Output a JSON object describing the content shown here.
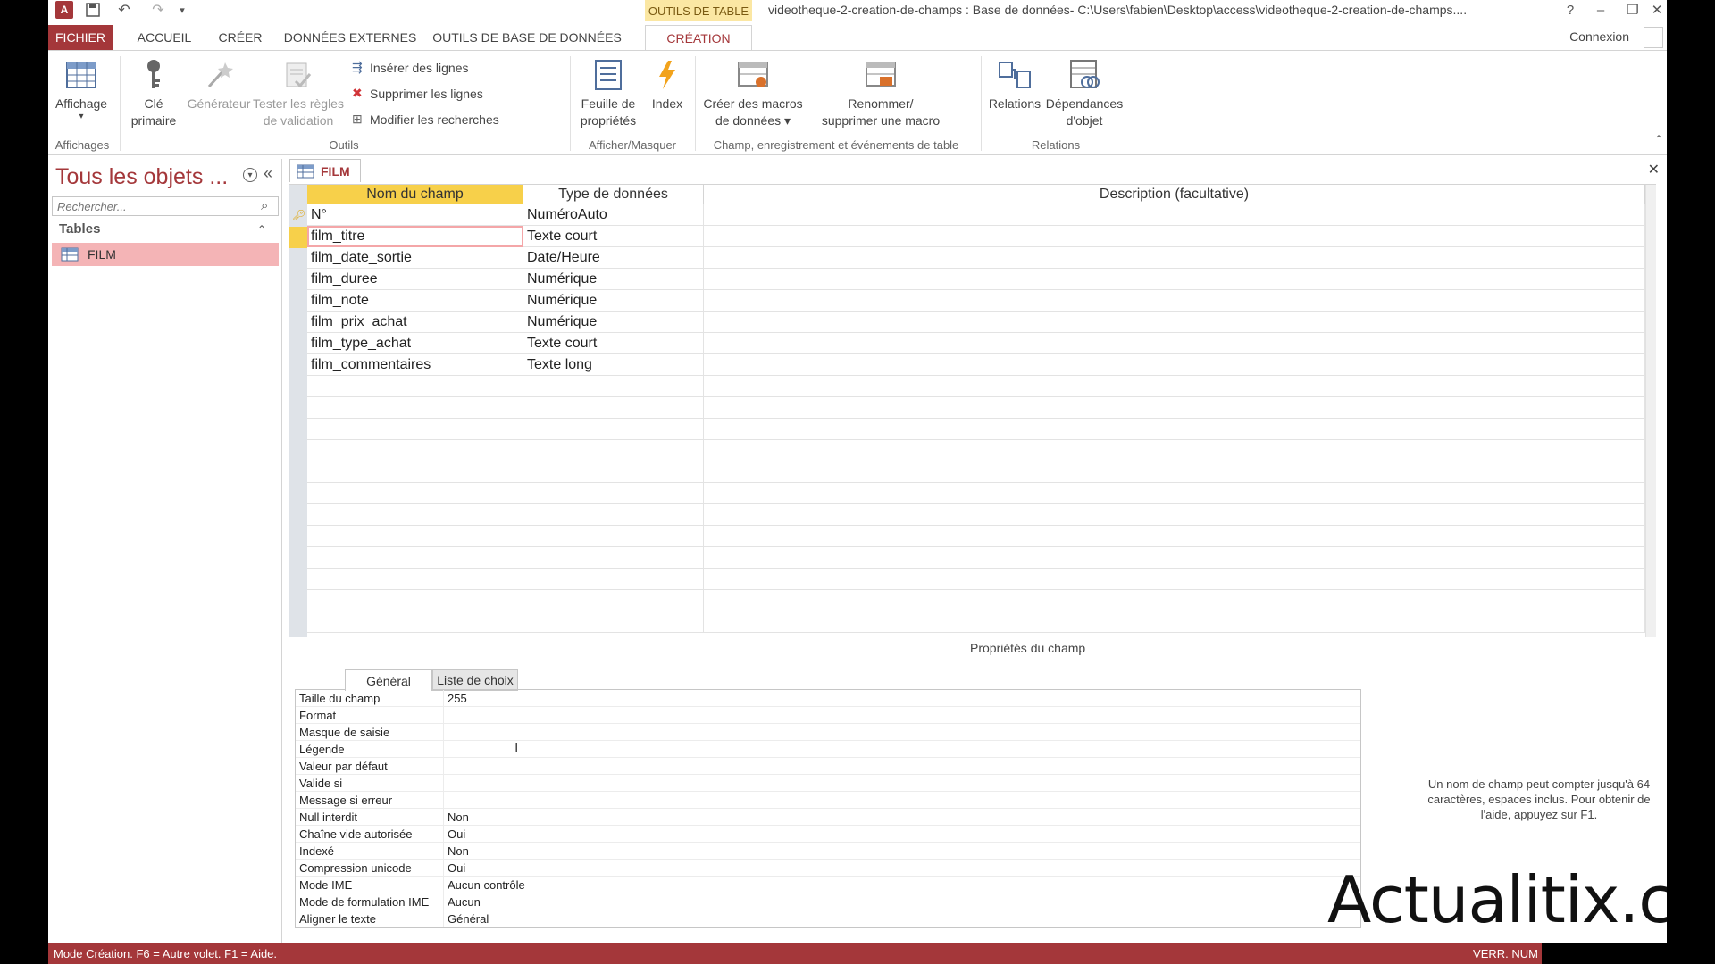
{
  "window": {
    "title": "videotheque-2-creation-de-champs : Base de données- C:\\Users\\fabien\\Desktop\\access\\videotheque-2-creation-de-champs....",
    "context_tab": "OUTILS DE TABLE",
    "help": "?",
    "connexion": "Connexion"
  },
  "ribbon_tabs": [
    "FICHIER",
    "ACCUEIL",
    "CRÉER",
    "DONNÉES EXTERNES",
    "OUTILS DE BASE DE DONNÉES",
    "CRÉATION"
  ],
  "ribbon": {
    "affichage": "Affichage",
    "cle": "Clé",
    "cle2": "primaire",
    "generateur": "Générateur",
    "tester": "Tester les règles",
    "tester2": "de validation",
    "inserer": "Insérer des lignes",
    "supprimer": "Supprimer les lignes",
    "modifier": "Modifier les recherches",
    "feuille": "Feuille de",
    "feuille2": "propriétés",
    "index": "Index",
    "creer_macros": "Créer des macros",
    "creer_macros2": "de données",
    "renommer": "Renommer/",
    "renommer2": "supprimer une macro",
    "relations": "Relations",
    "dependances": "Dépendances",
    "dependances2": "d'objet",
    "groups": {
      "affichages": "Affichages",
      "outils": "Outils",
      "afficher": "Afficher/Masquer",
      "champ": "Champ, enregistrement et événements de table",
      "relations": "Relations"
    }
  },
  "nav": {
    "title": "Tous les objets ...",
    "search_placeholder": "Rechercher...",
    "section": "Tables",
    "item": "FILM"
  },
  "doc": {
    "tab": "FILM",
    "headers": [
      "Nom du champ",
      "Type de données",
      "Description (facultative)"
    ],
    "rows": [
      {
        "name": "N°",
        "type": "NuméroAuto"
      },
      {
        "name": "film_titre",
        "type": "Texte court"
      },
      {
        "name": "film_date_sortie",
        "type": "Date/Heure"
      },
      {
        "name": "film_duree",
        "type": "Numérique"
      },
      {
        "name": "film_note",
        "type": "Numérique"
      },
      {
        "name": "film_prix_achat",
        "type": "Numérique"
      },
      {
        "name": "film_type_achat",
        "type": "Texte court"
      },
      {
        "name": "film_commentaires",
        "type": "Texte long"
      }
    ]
  },
  "props": {
    "title": "Propriétés du champ",
    "tabs": [
      "Général",
      "Liste de choix"
    ],
    "rows": [
      {
        "label": "Taille du champ",
        "value": "255"
      },
      {
        "label": "Format",
        "value": ""
      },
      {
        "label": "Masque de saisie",
        "value": ""
      },
      {
        "label": "Légende",
        "value": ""
      },
      {
        "label": "Valeur par défaut",
        "value": ""
      },
      {
        "label": "Valide si",
        "value": ""
      },
      {
        "label": "Message si erreur",
        "value": ""
      },
      {
        "label": "Null interdit",
        "value": "Non"
      },
      {
        "label": "Chaîne vide autorisée",
        "value": "Oui"
      },
      {
        "label": "Indexé",
        "value": "Non"
      },
      {
        "label": "Compression unicode",
        "value": "Oui"
      },
      {
        "label": "Mode IME",
        "value": "Aucun contrôle"
      },
      {
        "label": "Mode de formulation IME",
        "value": "Aucun"
      },
      {
        "label": "Aligner le texte",
        "value": "Général"
      }
    ],
    "help": "Un nom de champ peut compter jusqu'à 64 caractères, espaces inclus. Pour obtenir de l'aide, appuyez sur F1."
  },
  "watermark": "Actualitix.com",
  "status": {
    "left": "Mode Création. F6 = Autre volet. F1 = Aide.",
    "right": "VERR. NUM"
  },
  "colors": {
    "accent": "#a4373a",
    "context_tab": "#fbe7a3",
    "header_selected": "#f7d04a",
    "nav_selected": "#f4b4b6"
  }
}
